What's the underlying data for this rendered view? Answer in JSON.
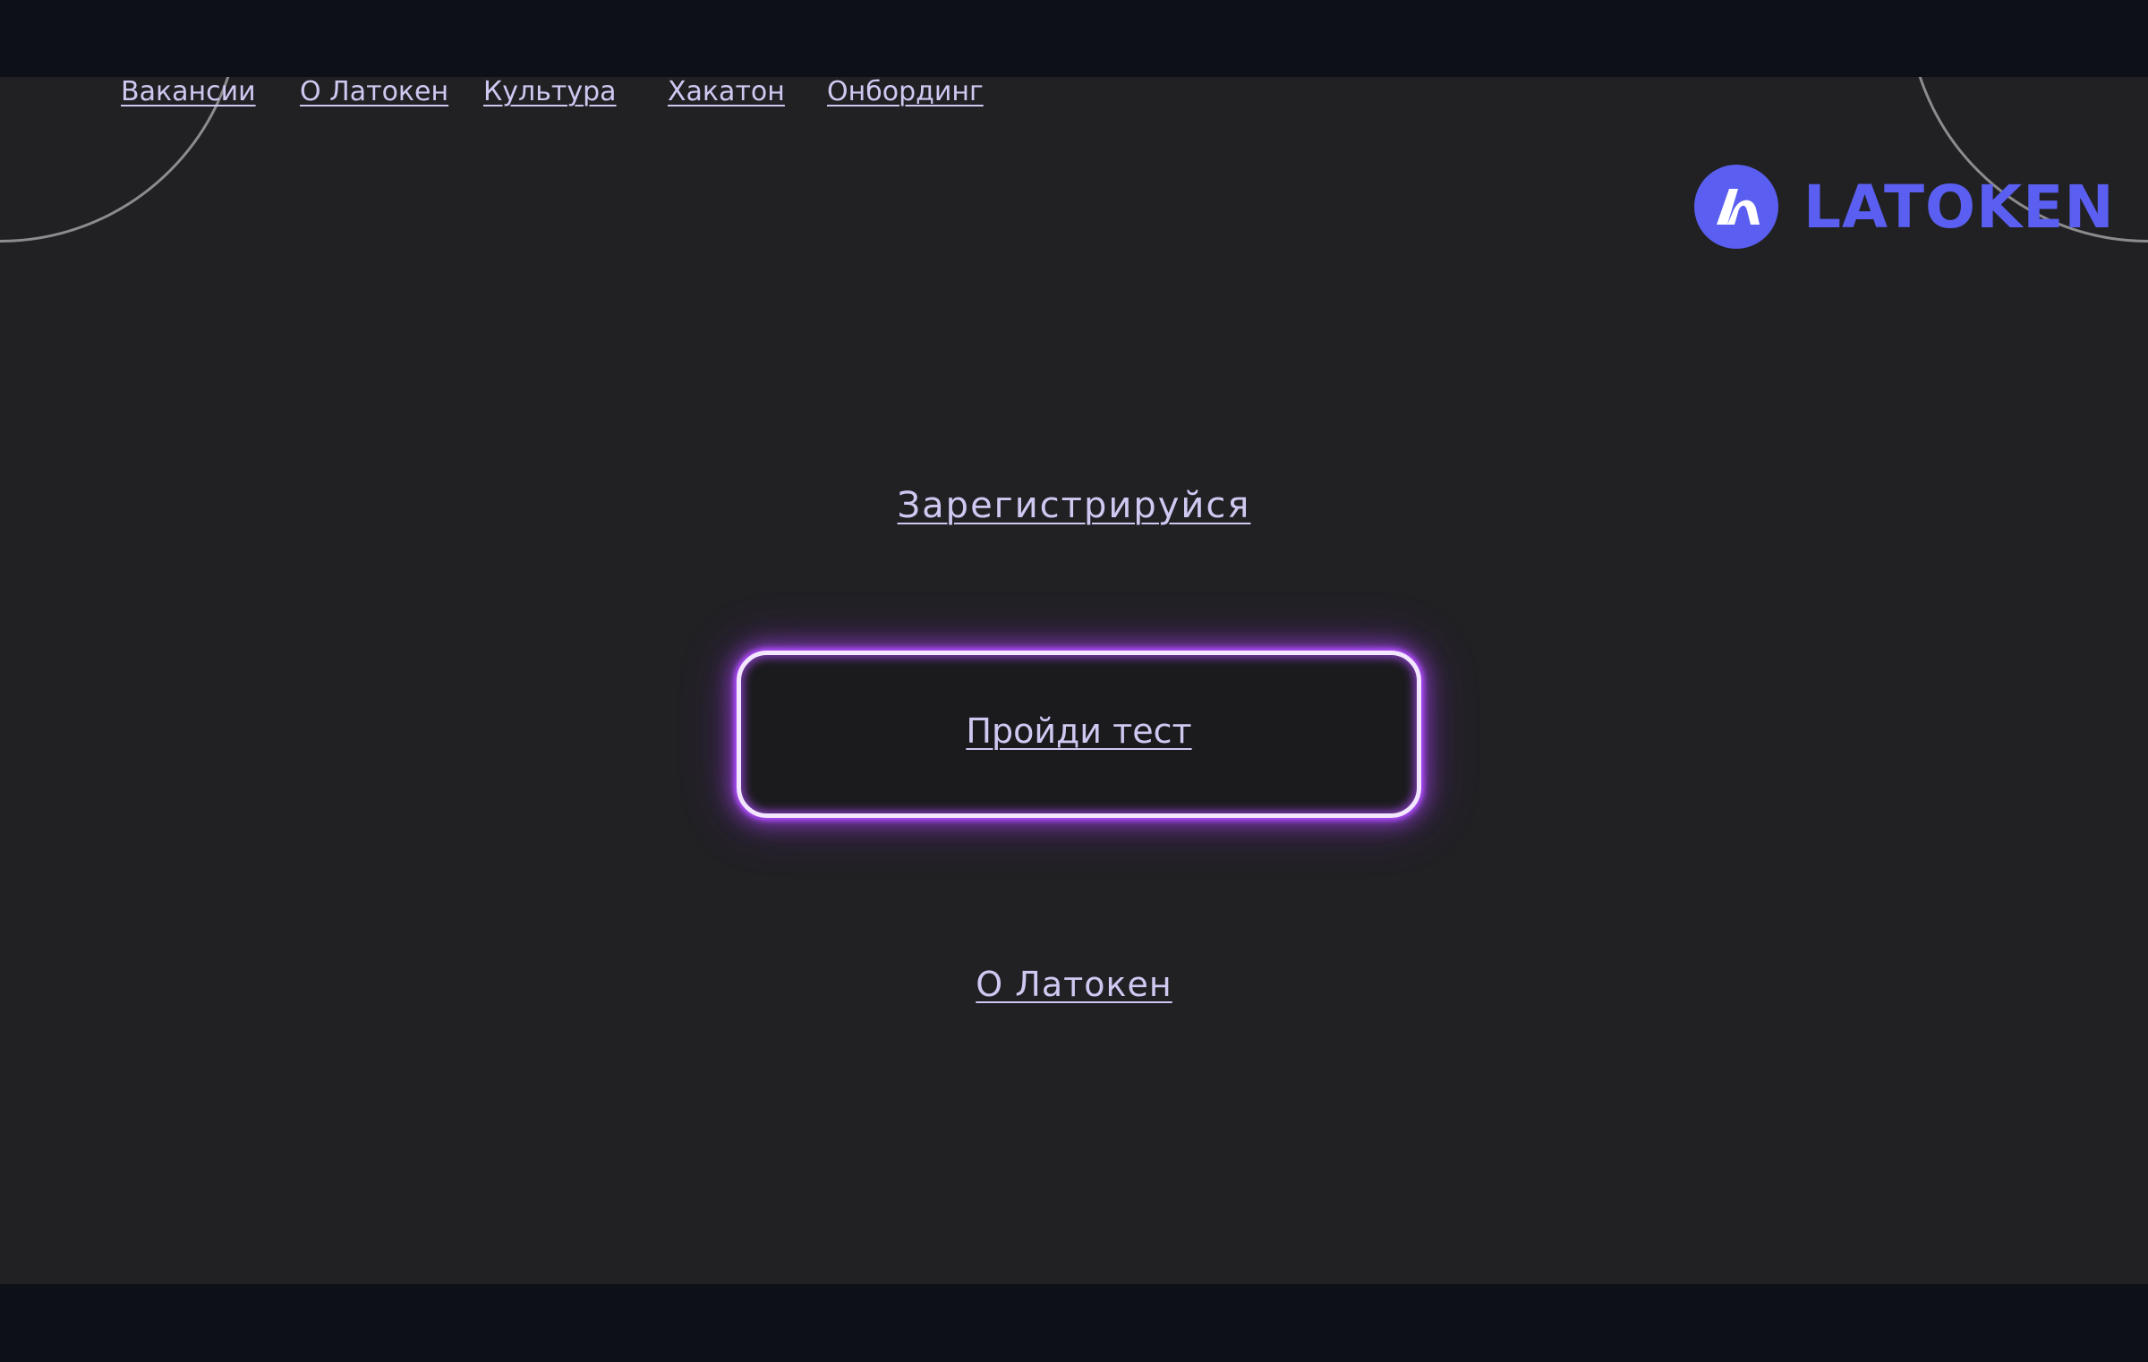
{
  "nav": {
    "items": [
      {
        "label": "Вакансии"
      },
      {
        "label": "О Латокен"
      },
      {
        "label": "Культура"
      },
      {
        "label": "Хакатон"
      },
      {
        "label": "Онбординг"
      }
    ]
  },
  "logo": {
    "text": "LATOKEN",
    "icon": "latoken-logo-icon",
    "color": "#5a5ff1"
  },
  "hero": {
    "register_link": "Зарегистрируйся",
    "test_button": "Пройди тест",
    "about_link": "О Латокен"
  },
  "colors": {
    "background": "#212124",
    "frame": "#0d1117",
    "link": "#cfc9f2",
    "neon": "#b04cff"
  }
}
